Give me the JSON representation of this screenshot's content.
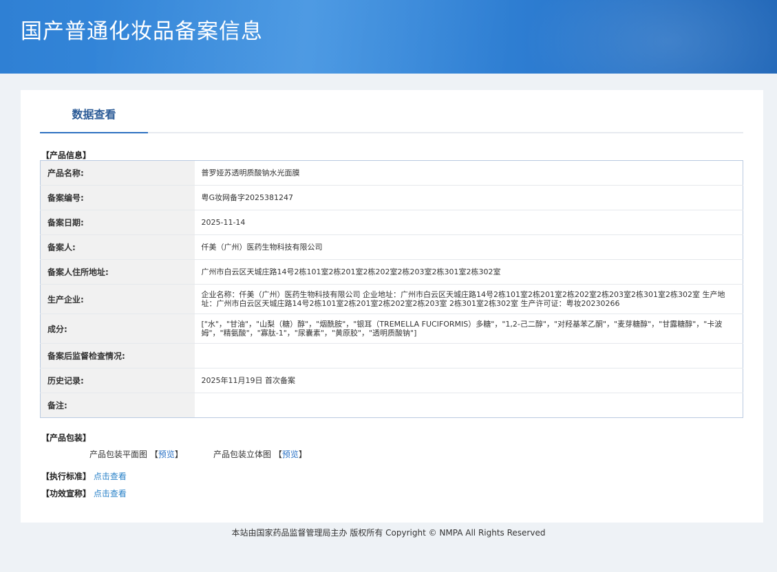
{
  "header": {
    "title": "国产普通化妆品备案信息"
  },
  "tabs": [
    {
      "label": "数据查看",
      "active": true
    }
  ],
  "product_info": {
    "section_label": "【产品信息】",
    "rows": [
      {
        "label": "产品名称:",
        "value": "普罗娅苏透明质酸钠水光面膜"
      },
      {
        "label": "备案编号:",
        "value": "粤G妆网备字2025381247"
      },
      {
        "label": "备案日期:",
        "value": "2025-11-14"
      },
      {
        "label": "备案人:",
        "value": "仟美（广州）医药生物科技有限公司"
      },
      {
        "label": "备案人住所地址:",
        "value": "广州市白云区天城庄路14号2栋101室2栋201室2栋202室2栋203室2栋301室2栋302室"
      },
      {
        "label": "生产企业:",
        "value": "企业名称：仟美（广州）医药生物科技有限公司 企业地址：广州市白云区天城庄路14号2栋101室2栋201室2栋202室2栋203室2栋301室2栋302室 生产地址：广州市白云区天城庄路14号2栋101室2栋201室2栋202室2栋203室 2栋301室2栋302室 生产许可证：粤妆20230266"
      },
      {
        "label": "成分:",
        "value": "[\"水\"，\"甘油\"，\"山梨（糖）醇\"，\"烟酰胺\"，\"银耳（TREMELLA FUCIFORMIS）多糖\"，\"1,2-己二醇\"，\"对羟基苯乙酮\"，\"麦芽糖醇\"，\"甘露糖醇\"，\"卡波姆\"，\"精氨酸\"，\"寡肽-1\"，\"尿囊素\"，\"黄原胶\"，\"透明质酸钠\"]"
      },
      {
        "label": "备案后监督检查情况:",
        "value": ""
      },
      {
        "label": "历史记录:",
        "value": "2025年11月19日 首次备案"
      },
      {
        "label": "备注:",
        "value": ""
      }
    ]
  },
  "packaging": {
    "section_label": "【产品包装】",
    "flat_label": "产品包装平面图",
    "solid_label": "产品包装立体图",
    "bracket_open": "【",
    "bracket_close": "】",
    "preview_label": "预览"
  },
  "standard": {
    "label": "【执行标准】",
    "link": "点击查看"
  },
  "efficacy": {
    "label": "【功效宣称】",
    "link": "点击查看"
  },
  "footer": {
    "text": "本站由国家药品监督管理局主办 版权所有 Copyright © NMPA All Rights Reserved"
  },
  "colors": {
    "header_blue": "#2f80d4",
    "tab_text": "#2a5a96",
    "link": "#2a72c6"
  }
}
